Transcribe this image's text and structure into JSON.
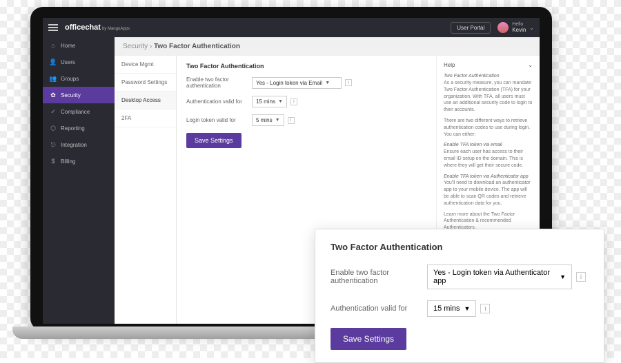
{
  "header": {
    "logo": "officechat",
    "logo_sub": "by MangoApps",
    "user_portal": "User Portal",
    "hello": "Hello",
    "username": "Kevin"
  },
  "sidebar": {
    "items": [
      {
        "icon": "⌂",
        "label": "Home"
      },
      {
        "icon": "👤",
        "label": "Users"
      },
      {
        "icon": "👥",
        "label": "Groups"
      },
      {
        "icon": "✿",
        "label": "Security"
      },
      {
        "icon": "✓",
        "label": "Compliance"
      },
      {
        "icon": "⬡",
        "label": "Reporting"
      },
      {
        "icon": "⎋",
        "label": "Integration"
      },
      {
        "icon": "$",
        "label": "Billing"
      }
    ]
  },
  "breadcrumb": {
    "a": "Security",
    "sep": " › ",
    "b": "Two Factor Authentication"
  },
  "subnav": [
    "Device Mgmt",
    "Password Settings",
    "Desktop Access",
    "2FA"
  ],
  "panel": {
    "title": "Two Factor Authentication",
    "enable_label": "Enable two factor authentication",
    "enable_value": "Yes - Login token via Email",
    "auth_label": "Authentication valid for",
    "auth_value": "15 mins",
    "token_label": "Login token valid for",
    "token_value": "5 mins",
    "save": "Save Settings"
  },
  "help": {
    "title": "Help",
    "h1": "Two Factor Authentication",
    "p1": "As a security measure, you can mandate Two Factor Authentication (TFA) for your organization. With TFA, all users must use an additional security code to login to their accounts.",
    "p2": "There are two different ways to retrieve authentication codes to use during login. You can either:",
    "h2": "Enable TFA token via email",
    "p3": "Ensure each user has access to their email ID setup on the domain. This is where they will get their secure code.",
    "h3": "Enable TFA token via Authenticator app",
    "p4": "You'll need to download an authenticator app to your mobile device. The app will be able to scan QR codes and retrieve authentication data for you.",
    "p5": "Learn more about the Two Factor Authentication & recommended Authenticators."
  },
  "popup": {
    "title": "Two Factor Authentication",
    "enable_label": "Enable two factor authentication",
    "enable_value": "Yes - Login token via Authenticator app",
    "auth_label": "Authentication valid for",
    "auth_value": "15 mins",
    "save": "Save Settings"
  }
}
